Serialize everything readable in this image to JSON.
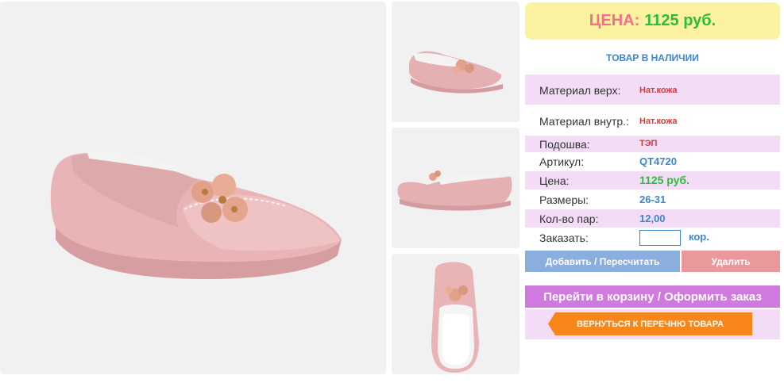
{
  "price": {
    "label": "ЦЕНА:",
    "value": "1125 руб."
  },
  "stock_status": "ТОВАР В НАЛИЧИИ",
  "specs": [
    {
      "label": "Материал верх:",
      "value": "Нат.кожа"
    },
    {
      "label": "Материал внутр.:",
      "value": "Нат.кожа"
    },
    {
      "label": "Подошва:",
      "value": "ТЭП"
    },
    {
      "label": "Артикул:",
      "value": "QT4720"
    },
    {
      "label": "Цена:",
      "value": "1125 руб."
    },
    {
      "label": "Размеры:",
      "value": "26-31"
    },
    {
      "label": "Кол-во пар:",
      "value": "12,00"
    }
  ],
  "order": {
    "label": "Заказать:",
    "quantity": "",
    "unit": "кор."
  },
  "buttons": {
    "recalc": "Добавить / Пересчитать",
    "delete": "Удалить",
    "cart": "Перейти в корзину / Оформить заказ",
    "back": "ВЕРНУТЬСЯ К ПЕРЕЧНЮ ТОВАРА"
  },
  "colors": {
    "accent_pink": "#f0728a",
    "price_green": "#2fbb3c",
    "link_blue": "#3d86cf",
    "row_pink": "#f2dcf6",
    "cart_purple": "#d07ae0",
    "back_orange": "#f7861b"
  }
}
